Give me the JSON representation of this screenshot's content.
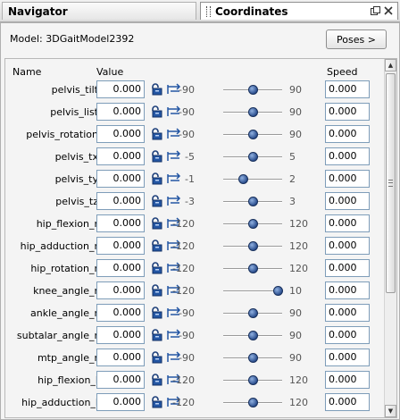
{
  "tabs": {
    "navigator": "Navigator",
    "coordinates": "Coordinates"
  },
  "model": {
    "label": "Model:",
    "name": "3DGaitModel2392"
  },
  "poses_button": "Poses >",
  "headers": {
    "name": "Name",
    "value": "Value",
    "speed": "Speed"
  },
  "coordinates": [
    {
      "name": "pelvis_tilt",
      "value": "0.000",
      "min": "-90",
      "max": "90",
      "slider": 0.5,
      "speed": "0.000"
    },
    {
      "name": "pelvis_list",
      "value": "0.000",
      "min": "-90",
      "max": "90",
      "slider": 0.5,
      "speed": "0.000"
    },
    {
      "name": "pelvis_rotation",
      "value": "0.000",
      "min": "-90",
      "max": "90",
      "slider": 0.5,
      "speed": "0.000"
    },
    {
      "name": "pelvis_tx",
      "value": "0.000",
      "min": "-5",
      "max": "5",
      "slider": 0.5,
      "speed": "0.000"
    },
    {
      "name": "pelvis_ty",
      "value": "0.000",
      "min": "-1",
      "max": "2",
      "slider": 0.333,
      "speed": "0.000"
    },
    {
      "name": "pelvis_tz",
      "value": "0.000",
      "min": "-3",
      "max": "3",
      "slider": 0.5,
      "speed": "0.000"
    },
    {
      "name": "hip_flexion_r",
      "value": "0.000",
      "min": "-120",
      "max": "120",
      "slider": 0.5,
      "speed": "0.000"
    },
    {
      "name": "hip_adduction_r",
      "value": "0.000",
      "min": "-120",
      "max": "120",
      "slider": 0.5,
      "speed": "0.000"
    },
    {
      "name": "hip_rotation_r",
      "value": "0.000",
      "min": "-120",
      "max": "120",
      "slider": 0.5,
      "speed": "0.000"
    },
    {
      "name": "knee_angle_r",
      "value": "0.000",
      "min": "-120",
      "max": "10",
      "slider": 0.923,
      "speed": "0.000"
    },
    {
      "name": "ankle_angle_r",
      "value": "0.000",
      "min": "-90",
      "max": "90",
      "slider": 0.5,
      "speed": "0.000"
    },
    {
      "name": "subtalar_angle_r",
      "value": "0.000",
      "min": "-90",
      "max": "90",
      "slider": 0.5,
      "speed": "0.000"
    },
    {
      "name": "mtp_angle_r",
      "value": "0.000",
      "min": "-90",
      "max": "90",
      "slider": 0.5,
      "speed": "0.000"
    },
    {
      "name": "hip_flexion_l",
      "value": "0.000",
      "min": "-120",
      "max": "120",
      "slider": 0.5,
      "speed": "0.000"
    },
    {
      "name": "hip_adduction_l",
      "value": "0.000",
      "min": "-120",
      "max": "120",
      "slider": 0.5,
      "speed": "0.000"
    }
  ],
  "icons": {
    "lock": "lock-icon",
    "clamp": "clamp-icon",
    "restore": "restore-window-icon",
    "close": "close-icon"
  }
}
